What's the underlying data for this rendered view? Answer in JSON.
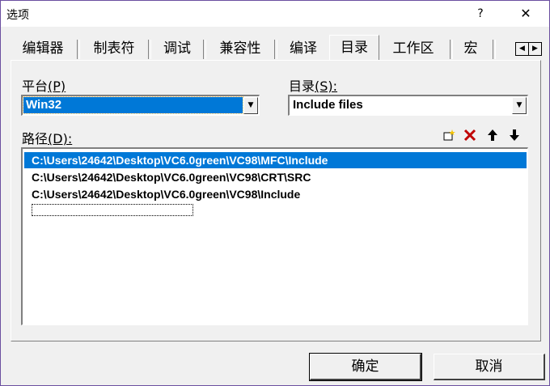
{
  "window": {
    "title": "选项",
    "help_label": "?",
    "close_label": "✕"
  },
  "tabs": [
    {
      "label": "编辑器"
    },
    {
      "label": "制表符"
    },
    {
      "label": "调试"
    },
    {
      "label": "兼容性"
    },
    {
      "label": "编译"
    },
    {
      "label": "目录",
      "active": true
    },
    {
      "label": "工作区"
    },
    {
      "label": "宏"
    }
  ],
  "tab_scroll": {
    "left": "◀",
    "right": "▶"
  },
  "platform": {
    "label": "平台",
    "mnemonic": "(P)",
    "value": "Win32"
  },
  "directory": {
    "label": "目录",
    "mnemonic": "(S):",
    "value": "Include files"
  },
  "paths": {
    "label": "路径",
    "mnemonic": "(D):",
    "items": [
      {
        "text": "C:\\Users\\24642\\Desktop\\VC6.0green\\VC98\\MFC\\Include",
        "selected": true
      },
      {
        "text": "C:\\Users\\24642\\Desktop\\VC6.0green\\VC98\\CRT\\SRC",
        "selected": false
      },
      {
        "text": "C:\\Users\\24642\\Desktop\\VC6.0green\\VC98\\Include",
        "selected": false
      }
    ]
  },
  "toolbar_icons": {
    "new": "new-folder-icon",
    "delete": "delete-icon",
    "move_up": "arrow-up-icon",
    "move_down": "arrow-down-icon",
    "delete_color": "#c00000"
  },
  "buttons": {
    "ok": "确定",
    "cancel": "取消"
  },
  "colors": {
    "selection": "#0078d7",
    "border": "#6b4fa0"
  }
}
